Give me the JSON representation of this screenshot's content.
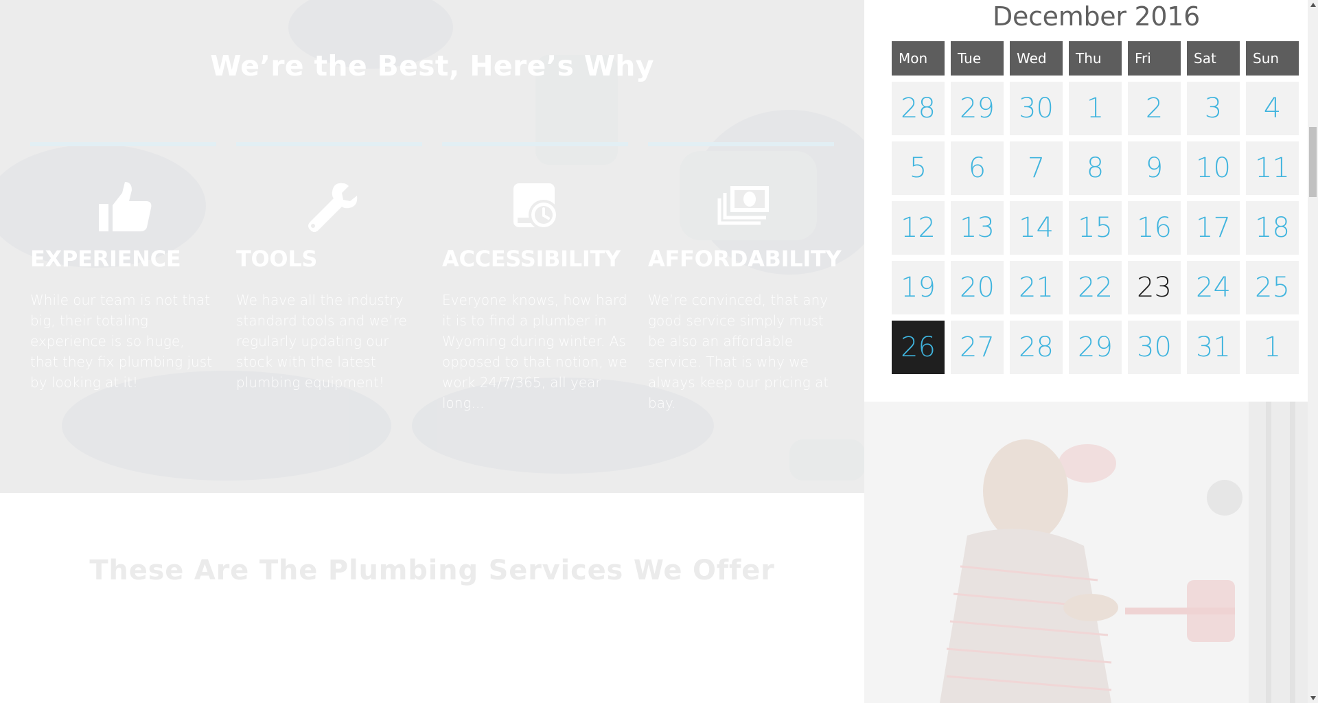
{
  "why_section": {
    "title": "We’re the Best, Here’s Why",
    "features": [
      {
        "icon": "thumbs-up-icon",
        "title": "EXPERIENCE",
        "text": "While our team is not that big, their totaling experience is so huge, that they fix plumbing just by looking at it!"
      },
      {
        "icon": "wrench-icon",
        "title": "TOOLS",
        "text": "We have all the industry standard tools and we’re regularly updating our stock with the latest plumbing equipment!"
      },
      {
        "icon": "calendar-clock-icon",
        "title": "ACCESSIBILITY",
        "text": "Everyone knows, how hard it is to find a plumber in Wyoming during winter. As opposed to that notion, we work 24/7/365, all year long..."
      },
      {
        "icon": "money-icon",
        "title": "AFFORDABILITY",
        "text": "We’re convinced, that any good service simply must be also an affordable service. That is why we always keep our pricing at bay."
      }
    ]
  },
  "services": {
    "title": "These Are The Plumbing Services We Offer"
  },
  "calendar": {
    "title": "December 2016",
    "weekdays": [
      "Mon",
      "Tue",
      "Wed",
      "Thu",
      "Fri",
      "Sat",
      "Sun"
    ],
    "weeks": [
      [
        "28",
        "29",
        "30",
        "1",
        "2",
        "3",
        "4"
      ],
      [
        "5",
        "6",
        "7",
        "8",
        "9",
        "10",
        "11"
      ],
      [
        "12",
        "13",
        "14",
        "15",
        "16",
        "17",
        "18"
      ],
      [
        "19",
        "20",
        "21",
        "22",
        "23",
        "24",
        "25"
      ],
      [
        "26",
        "27",
        "28",
        "29",
        "30",
        "31",
        "1"
      ]
    ],
    "today": "23",
    "selected": "26"
  },
  "colors": {
    "accent": "#3fb4de",
    "weekday_header": "#5d5d5d",
    "selected_day_bg": "#1f1f1f",
    "day_cell_bg": "#f2f2f2"
  }
}
